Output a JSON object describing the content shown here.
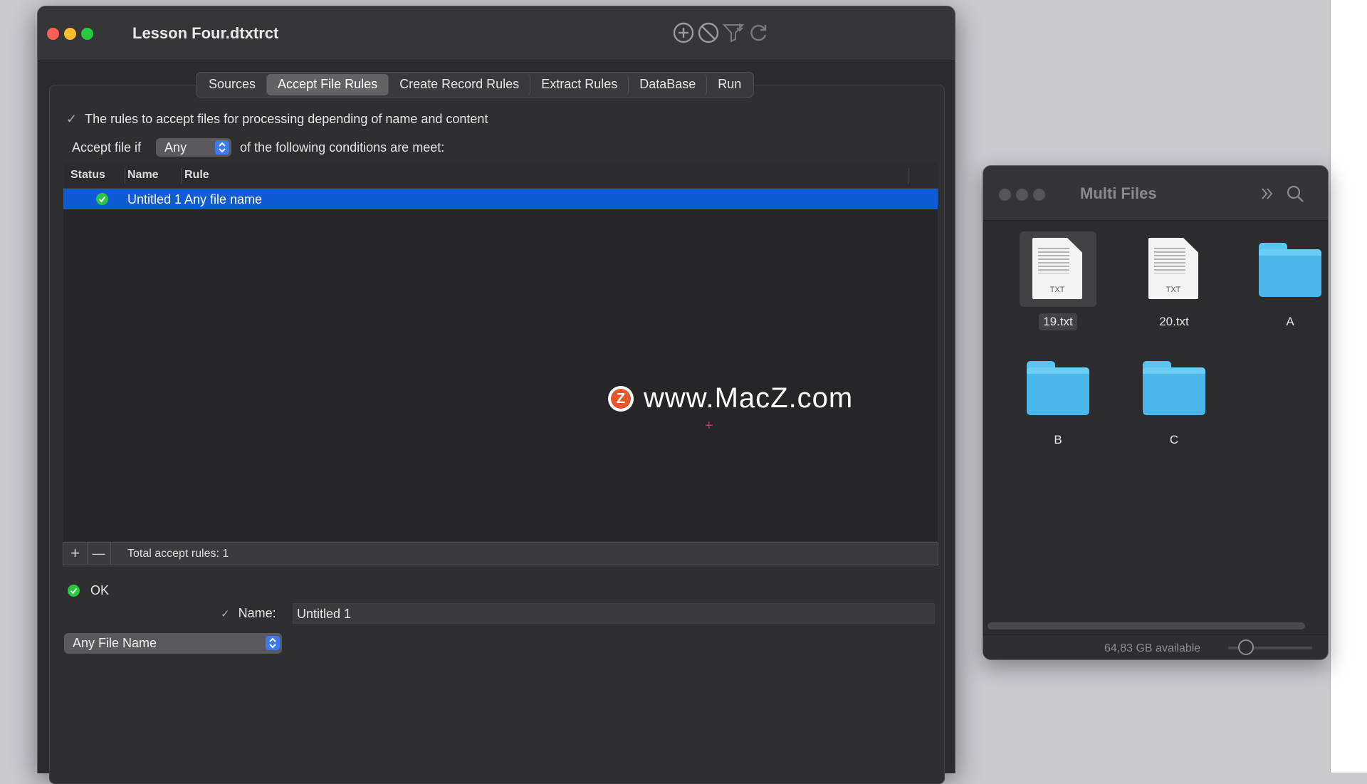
{
  "main_window": {
    "title": "Lesson Four.dtxtrct",
    "tabs": [
      "Sources",
      "Accept File Rules",
      "Create Record Rules",
      "Extract Rules",
      "DataBase",
      "Run"
    ],
    "active_tab": "Accept File Rules",
    "description": "The rules to accept files for processing depending of name and content",
    "accept_label": "Accept file if",
    "accept_mode": "Any",
    "accept_suffix": "of the following conditions are meet:",
    "table": {
      "columns": [
        "Status",
        "Name",
        "Rule"
      ],
      "rows": [
        {
          "status": "ok",
          "name": "Untitled 1",
          "rule": "Any file name"
        }
      ]
    },
    "footer": {
      "add": "+",
      "remove": "—",
      "total": "Total accept rules: 1"
    },
    "detail": {
      "status_text": "OK",
      "name_label": "Name:",
      "name_value": "Untitled 1",
      "rule_type": "Any File Name"
    },
    "toolbar_icons": [
      "plus-circle-icon",
      "prohibit-icon",
      "filter-download-icon",
      "refresh-icon"
    ]
  },
  "watermark": {
    "logo_letter": "Z",
    "text": "www.MacZ.com"
  },
  "finder_window": {
    "title": "Multi Files",
    "items": [
      {
        "name": "19.txt",
        "kind": "txt",
        "tag": "TXT",
        "selected": true
      },
      {
        "name": "20.txt",
        "kind": "txt",
        "tag": "TXT",
        "selected": false
      },
      {
        "name": "A",
        "kind": "folder",
        "selected": false
      },
      {
        "name": "B",
        "kind": "folder",
        "selected": false
      },
      {
        "name": "C",
        "kind": "folder",
        "selected": false
      }
    ],
    "available": "64,83 GB available"
  },
  "colors": {
    "close": "#ff5f57",
    "minimize": "#febc2e",
    "zoom": "#28c840",
    "selection": "#0f5bd6",
    "accent": "#3d7af0",
    "folder": "#4bb6ea"
  }
}
